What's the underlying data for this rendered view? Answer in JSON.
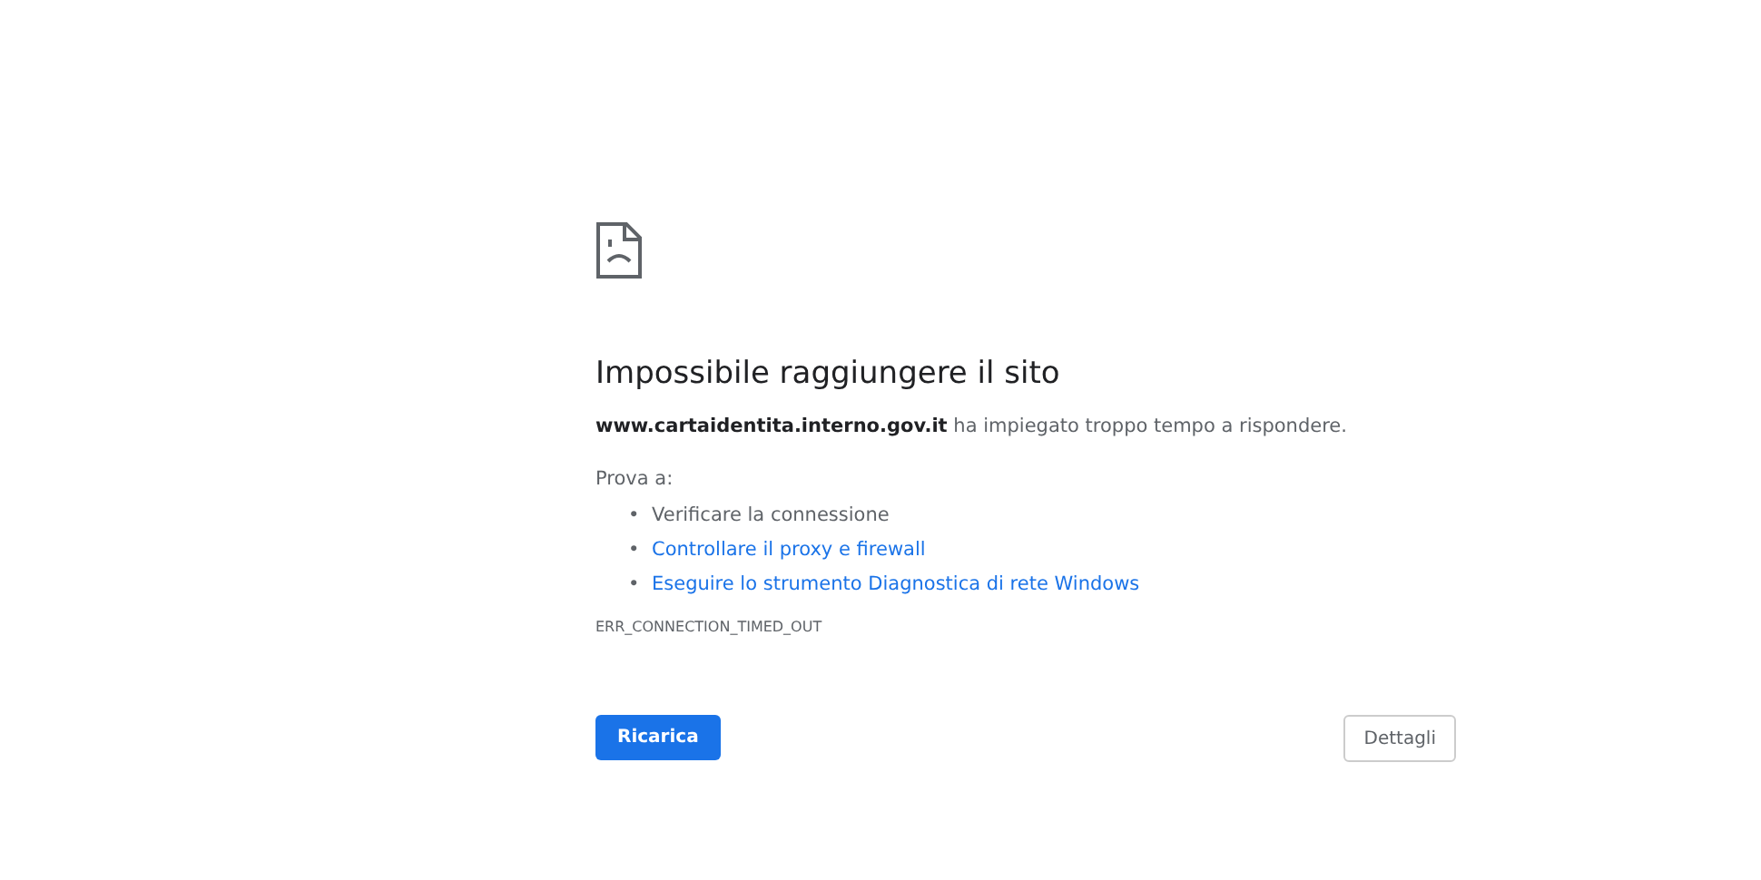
{
  "title": "Impossibile raggiungere il sito",
  "message": "**www.cartaidentita.interno.gov.it** ha impiegato troppo tempo a rispondere.",
  "suggestions_heading": "Prova a:",
  "suggestions": [
    {
      "kind": "text",
      "bullet": "•",
      "label": "Verificare la connessione"
    },
    {
      "kind": "link",
      "bullet": "•",
      "label": "Controllare il proxy e firewall"
    },
    {
      "kind": "link",
      "bullet": "•",
      "label": "Eseguire lo strumento Diagnostica di rete Windows"
    }
  ],
  "error_code": "ERR_CONNECTION_TIMED_OUT",
  "buttons": {
    "reload": "Ricarica",
    "details": "Dettagli"
  }
}
